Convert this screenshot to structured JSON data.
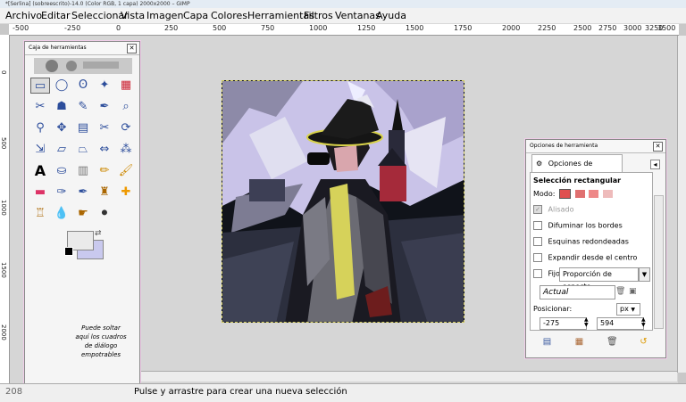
{
  "window": {
    "title": "*[Serlina] (sobreescrito)-14.0 (Color RGB, 1 capa) 2000x2000 – GIMP"
  },
  "menu": [
    "Archivo",
    "Editar",
    "Seleccionar",
    "Vista",
    "Imagen",
    "Capa",
    "Colores",
    "Herramientas",
    "Filtros",
    "Ventanas",
    "Ayuda"
  ],
  "ruler": {
    "top": [
      "-500",
      "-250",
      "0",
      "250",
      "500",
      "750",
      "1000",
      "1250",
      "1500",
      "1750",
      "2000",
      "2250",
      "2500",
      "2750",
      "3000",
      "3250",
      "3500"
    ],
    "left": [
      "0",
      "500",
      "1000",
      "1500",
      "2000"
    ]
  },
  "toolbox": {
    "title": "Caja de herramientas",
    "drop_hint": "Puede soltar aquí los cuadros de diálogo empotrables",
    "colors": {
      "foreground": "#eaeaea",
      "background": "#c9c9ee"
    },
    "tools": [
      "rect-select-icon",
      "ellipse-select-icon",
      "lasso-icon",
      "fuzzy-select-icon",
      "select-by-color-icon",
      "scissors-icon",
      "foreground-select-icon",
      "paths-icon",
      "color-picker-icon",
      "zoom-icon",
      "measure-icon",
      "move-icon",
      "align-icon",
      "crop-icon",
      "rotate-icon",
      "scale-icon",
      "shear-icon",
      "perspective-icon",
      "flip-icon",
      "cage-icon",
      "text-icon",
      "bucket-fill-icon",
      "blend-icon",
      "pencil-icon",
      "paintbrush-icon",
      "eraser-icon",
      "airbrush-icon",
      "ink-icon",
      "clone-icon",
      "heal-icon",
      "perspective-clone-icon",
      "blur-icon",
      "smudge-icon",
      "dodge-burn-icon"
    ]
  },
  "tool_options": {
    "title": "Opciones de herramienta",
    "tab_label": "Opciones de herramienta",
    "tool_name": "Selección rectangular",
    "mode_label": "Modo:",
    "antialias": "Alisado",
    "feather": "Difuminar los bordes",
    "rounded": "Esquinas redondeadas",
    "expand": "Expandir desde el centro",
    "fixed_label": "Fijo:",
    "fixed_value": "Proporción de aspecto",
    "current": "Actual",
    "position_label": "Posicionar:",
    "unit": "px",
    "pos_x": "-275",
    "pos_y": "594"
  },
  "status": {
    "coords": "208",
    "message": "Pulse y arrastre para crear una nueva selección"
  }
}
